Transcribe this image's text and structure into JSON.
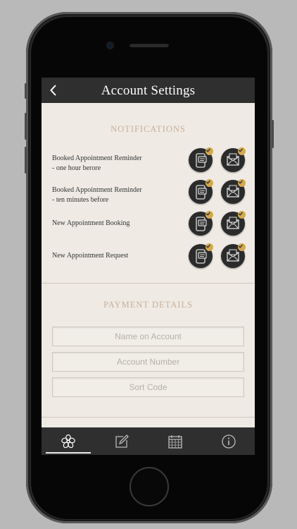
{
  "nav": {
    "title": "Account Settings"
  },
  "notifications": {
    "title": "NOTIFICATIONS",
    "items": [
      {
        "line1": "Booked Appointment Reminder",
        "line2": "- one hour berore",
        "sms_on": true,
        "email_on": true
      },
      {
        "line1": "Booked Appointment Reminder",
        "line2": "- ten minutes before",
        "sms_on": true,
        "email_on": true
      },
      {
        "line1": "New Appointment Booking",
        "line2": "",
        "sms_on": true,
        "email_on": true
      },
      {
        "line1": "New Appointment Request",
        "line2": "",
        "sms_on": true,
        "email_on": true
      }
    ]
  },
  "payment": {
    "title": "PAYMENT DETAILS",
    "name_placeholder": "Name on Account",
    "account_placeholder": "Account Number",
    "sort_placeholder": "Sort Code"
  },
  "tabs": [
    {
      "icon": "flower-icon",
      "selected": true
    },
    {
      "icon": "edit-icon",
      "selected": false
    },
    {
      "icon": "calendar-icon",
      "selected": false
    },
    {
      "icon": "info-icon",
      "selected": false
    }
  ],
  "colors": {
    "accent": "#c8ae9b",
    "badge": "#d3a94f",
    "bar": "#2f2f2f",
    "background": "#efebe4"
  }
}
